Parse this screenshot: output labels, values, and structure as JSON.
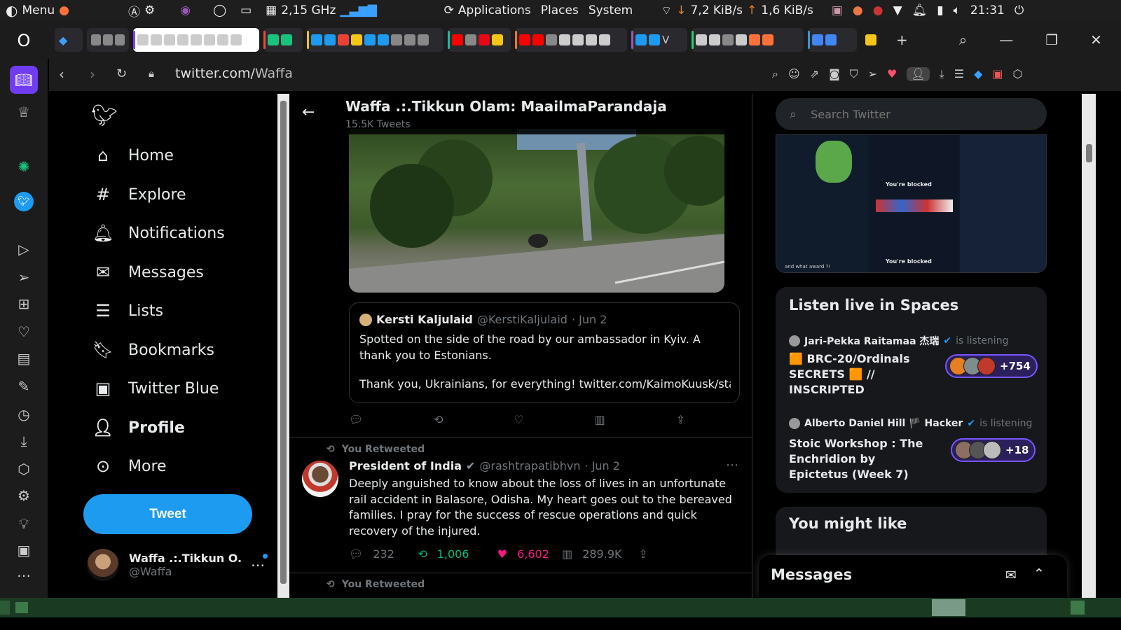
{
  "system_bar": {
    "menu_label": "Menu",
    "cpu_freq": "2,15 GHz",
    "apps": [
      "Applications",
      "Places",
      "System"
    ],
    "net_down": "7,2 KiB/s",
    "net_up": "1,6 KiB/s",
    "clock": "21:31"
  },
  "browser": {
    "url_domain": "twitter.com/",
    "url_path": "Waffa"
  },
  "twitter": {
    "nav": [
      {
        "label": "Home",
        "icon": "home-icon"
      },
      {
        "label": "Explore",
        "icon": "hashtag-icon"
      },
      {
        "label": "Notifications",
        "icon": "bell-icon"
      },
      {
        "label": "Messages",
        "icon": "mail-icon"
      },
      {
        "label": "Lists",
        "icon": "list-icon"
      },
      {
        "label": "Bookmarks",
        "icon": "bookmark-icon"
      },
      {
        "label": "Twitter Blue",
        "icon": "twitter-blue-icon"
      },
      {
        "label": "Profile",
        "icon": "person-icon"
      },
      {
        "label": "More",
        "icon": "more-circle-icon"
      }
    ],
    "tweet_button": "Tweet",
    "account": {
      "name": "Waffa .:.Tikkun O...",
      "handle": "@Waffa"
    },
    "header": {
      "name": "Waffa .:.Tikkun Olam: MaailmaParandaja",
      "count": "15.5K Tweets"
    },
    "quoted": {
      "author": "Kersti Kaljulaid",
      "handle": "@KerstiKaljulaid",
      "date": "· Jun 2",
      "text1": "Spotted on the side of the road by our ambassador in Kyiv. A thank you to Estonians.",
      "text2": "Thank you, Ukrainians, for everything! twitter.com/KaimoKuusk/sta..."
    },
    "tweet2": {
      "retweet_label": "You Retweeted",
      "author": "President of India",
      "handle": "@rashtrapatibhvn",
      "date": "· Jun 2",
      "text": "Deeply anguished to know about the loss of lives in an unfortunate rail accident in Balasore, Odisha. My heart goes out to the bereaved families. I pray for the success of rescue operations and quick recovery of the injured.",
      "replies": "232",
      "retweets": "1,006",
      "likes": "6,602",
      "views": "289.9K"
    },
    "tweet3_retweet_label": "You Retweeted",
    "search_placeholder": "Search Twitter",
    "spaces": {
      "title": "Listen live in Spaces",
      "items": [
        {
          "host": "Jari-Pekka Raitamaa 杰瑞",
          "status": "is listening",
          "title": "🟧 BRC-20/Ordinals SECRETS 🟧 // INSCRIPTED",
          "listeners": "+754"
        },
        {
          "host": "Alberto Daniel Hill 🏴 Hacker",
          "status": "is listening",
          "title": "Stoic Workshop : The Enchridion by Epictetus (Week 7)",
          "listeners": "+18"
        }
      ]
    },
    "thumb_texts": {
      "blocked": "You're blocked",
      "award": "and what award ?!"
    },
    "might_like": "You might like",
    "messages_drawer": "Messages"
  },
  "colors": {
    "accent": "#1d9bf0",
    "retweet": "#00ba7c",
    "like": "#f91880",
    "bg": "#000000"
  }
}
